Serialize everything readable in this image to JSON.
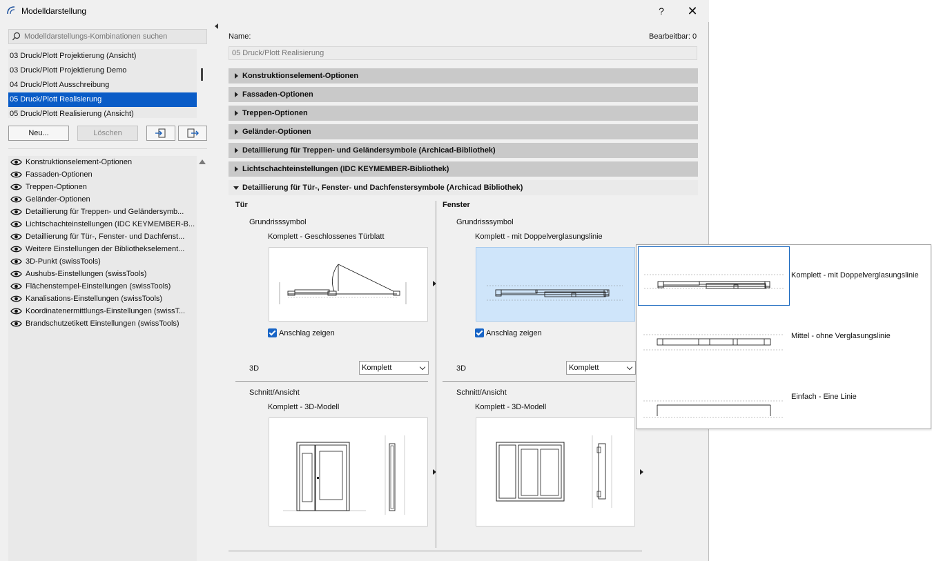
{
  "window": {
    "title": "Modelldarstellung",
    "help_label": "?",
    "close_label": "✕"
  },
  "search": {
    "placeholder": "Modelldarstellungs-Kombinationen suchen",
    "value": ""
  },
  "combinations": [
    {
      "label": "03 Druck/Plott Projektierung (Ansicht)",
      "selected": false
    },
    {
      "label": "03 Druck/Plott Projektierung Demo",
      "selected": false
    },
    {
      "label": "04 Druck/Plott Ausschreibung",
      "selected": false
    },
    {
      "label": "05 Druck/Plott Realisierung",
      "selected": true
    },
    {
      "label": "05 Druck/Plott Realisierung (Ansicht)",
      "selected": false
    }
  ],
  "buttons": {
    "new_label": "Neu...",
    "delete_label": "Löschen"
  },
  "option_list": [
    "Konstruktionselement-Optionen",
    "Fassaden-Optionen",
    "Treppen-Optionen",
    "Geländer-Optionen",
    "Detaillierung für Treppen- und Geländersymb...",
    "Lichtschachteinstellungen (IDC KEYMEMBER-B...",
    "Detaillierung für Tür-, Fenster- und Dachfenst...",
    "Weitere Einstellungen der Bibliothekselement...",
    "3D-Punkt (swissTools)",
    "Aushubs-Einstellungen (swissTools)",
    "Flächenstempel-Einstellungen (swissTools)",
    "Kanalisations-Einstellungen (swissTools)",
    "Koordinatenermittlungs-Einstellungen (swissT...",
    "Brandschutzetikett Einstellungen (swissTools)"
  ],
  "detail": {
    "name_label": "Name:",
    "editable_label": "Bearbeitbar: 0",
    "name_value": "05 Druck/Plott Realisierung",
    "sections": [
      "Konstruktionselement-Optionen",
      "Fassaden-Optionen",
      "Treppen-Optionen",
      "Geländer-Optionen",
      "Detaillierung für Treppen- und Geländersymbole (Archicad-Bibliothek)",
      "Lichtschachteinstellungen (IDC KEYMEMBER-Bibliothek)"
    ],
    "open_section": "Detaillierung für Tür-, Fenster- und Dachfenstersymbole (Archicad Bibliothek)"
  },
  "door": {
    "title": "Tür",
    "plan_label": "Grundrisssymbol",
    "plan_value": "Komplett - Geschlossenes Türblatt",
    "swing_label": "Anschlag zeigen",
    "swing_checked": true,
    "3d_label": "3D",
    "3d_value": "Komplett",
    "section_label": "Schnitt/Ansicht",
    "section_value": "Komplett - 3D-Modell"
  },
  "window_col": {
    "title": "Fenster",
    "plan_label": "Grundrisssymbol",
    "plan_value": "Komplett - mit Doppelverglasungslinie",
    "swing_label": "Anschlag zeigen",
    "swing_checked": true,
    "3d_label": "3D",
    "3d_value": "Komplett",
    "section_label": "Schnitt/Ansicht",
    "section_value": "Komplett - 3D-Modell"
  },
  "popup": {
    "options": [
      {
        "label": "Komplett - mit Doppelverglasungslinie",
        "selected": true
      },
      {
        "label": "Mittel - ohne Verglasungslinie",
        "selected": false
      },
      {
        "label": "Einfach - Eine Linie",
        "selected": false
      }
    ]
  },
  "colors": {
    "selection": "#0a5cc7",
    "section_bar": "#c9c9c9",
    "preview_selected": "#cfe5fa",
    "checkbox": "#1764c6"
  }
}
